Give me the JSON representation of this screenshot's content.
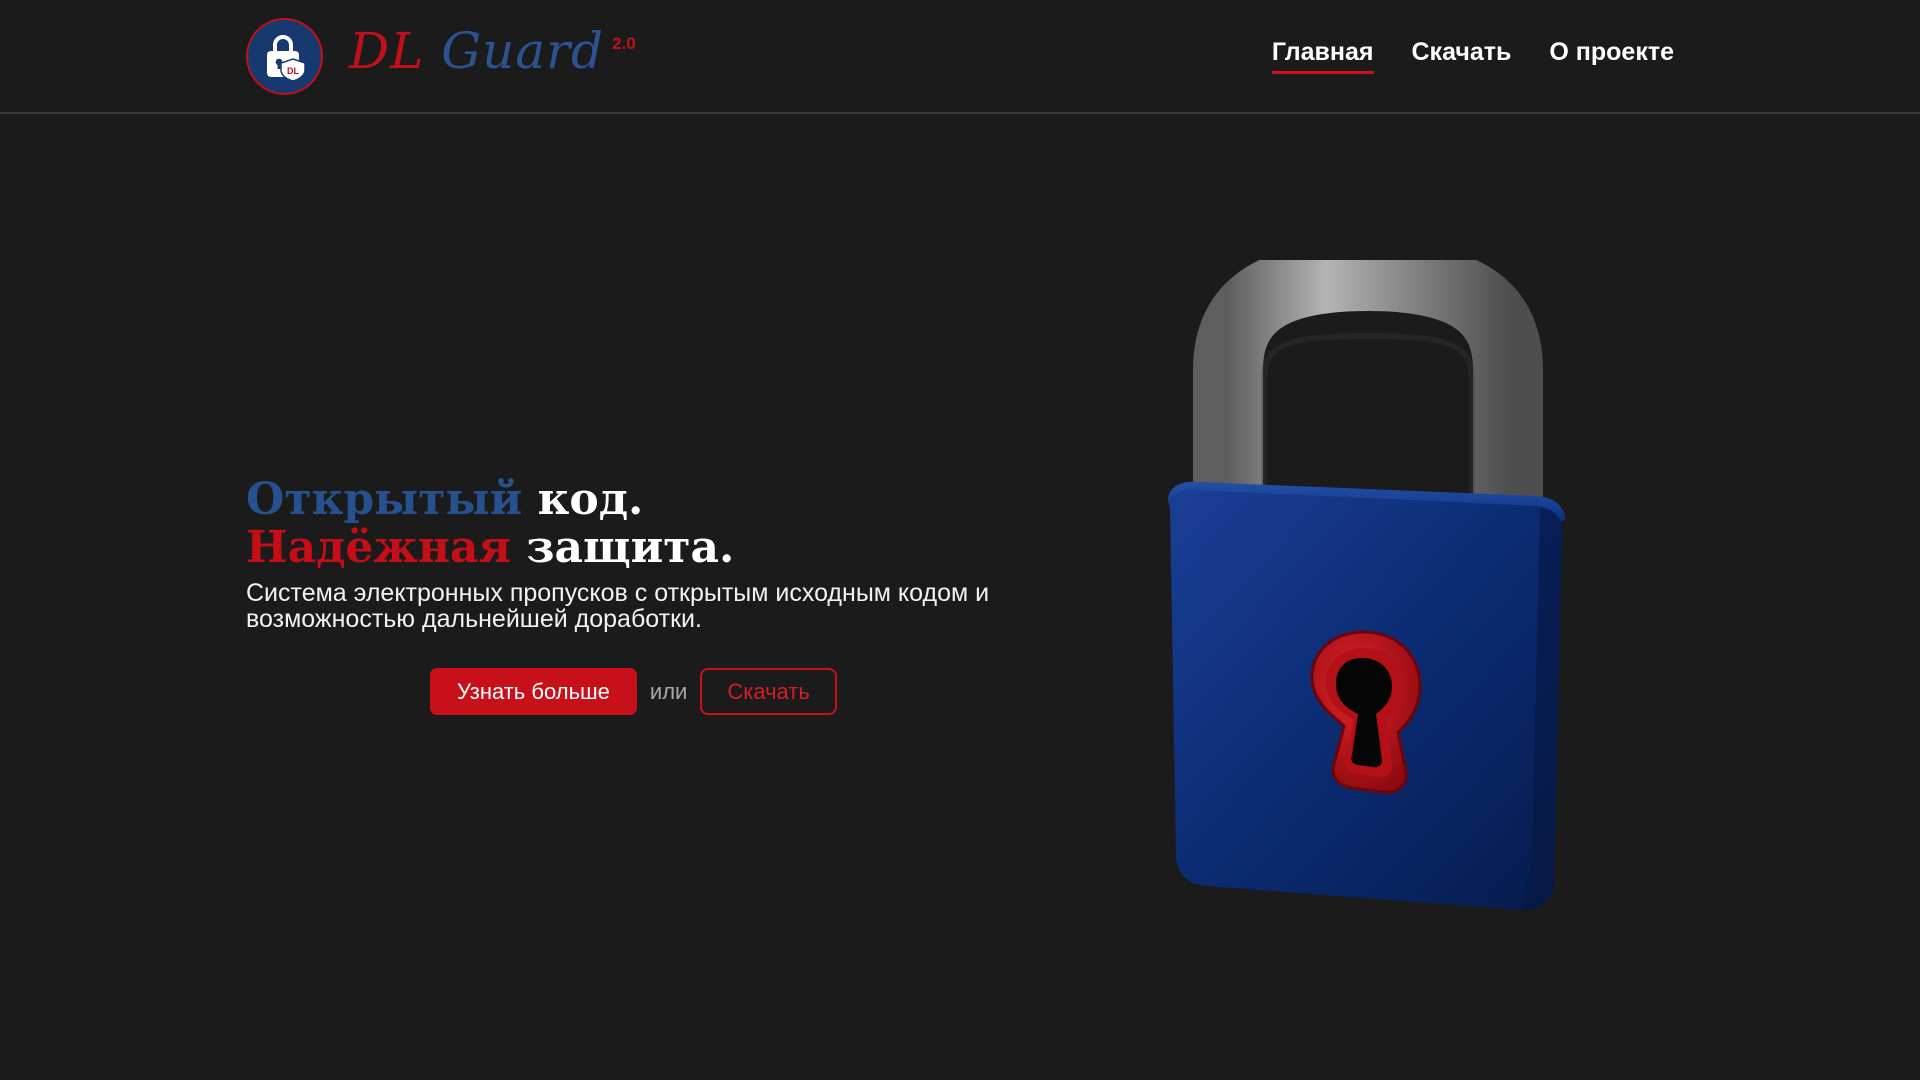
{
  "header": {
    "brand_part1": "DL",
    "brand_part2": "Guard",
    "brand_version": "2.0",
    "logo_icon": "lock-shield-icon",
    "nav": [
      {
        "label": "Главная",
        "active": true
      },
      {
        "label": "Скачать",
        "active": false
      },
      {
        "label": "О проекте",
        "active": false
      }
    ]
  },
  "hero": {
    "headline_line1_accent": "Открытый",
    "headline_line1_rest": " код.",
    "headline_line2_accent": "Надёжная",
    "headline_line2_rest": " защита.",
    "lead": "Система электронных пропусков с открытым исходным кодом и возможностью дальнейшей доработки.",
    "primary_button": "Узнать больше",
    "or_text": "или",
    "secondary_button": "Скачать",
    "illustration": "padlock-icon"
  },
  "colors": {
    "background": "#1b1b1b",
    "accent_red": "#c8101a",
    "accent_blue": "#27508e",
    "padlock_body": "#0a2a6e",
    "padlock_shackle": "#8a8a8a"
  }
}
